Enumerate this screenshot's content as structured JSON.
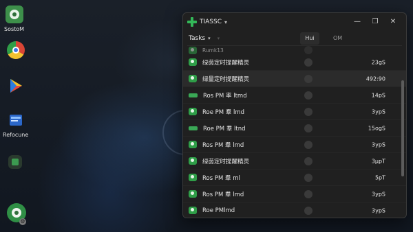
{
  "desktop": {
    "icons": [
      {
        "name": "sosto-app",
        "label": "SostoM"
      },
      {
        "name": "chrome",
        "label": ""
      },
      {
        "name": "play-store",
        "label": ""
      },
      {
        "name": "recycle",
        "label": "Refocune"
      },
      {
        "name": "app-tile",
        "label": ""
      }
    ]
  },
  "window": {
    "title": "TIASSC",
    "controls": {
      "minimize": "—",
      "maximize": "❐",
      "close": "✕"
    },
    "toolbar": {
      "tasks_label": "Tasks",
      "col_hui": "Hui",
      "col_om": "OM"
    },
    "rows": [
      {
        "label": "Rumk13",
        "value": "",
        "icon": "green",
        "partial": true
      },
      {
        "label": "绿茵定时提醒精灵",
        "value": "23gS",
        "icon": "green"
      },
      {
        "label": "绿量定时提醒精灵",
        "value": "492:90",
        "icon": "green",
        "selected": true
      },
      {
        "label": "Ros PM 率 ltmd",
        "value": "14pS",
        "icon": "bar"
      },
      {
        "label": "Roe PM 羣 lmd",
        "value": "3ypS",
        "icon": "green"
      },
      {
        "label": "Roe PM 羣 ltnd",
        "value": "15ogS",
        "icon": "bar"
      },
      {
        "label": "Ros PM 羣 lmd",
        "value": "3ypS",
        "icon": "green"
      },
      {
        "label": "绿茵定时提醒精灵",
        "value": "3μpT",
        "icon": "green"
      },
      {
        "label": "Ros PM 羣 ml",
        "value": "5pT",
        "icon": "green"
      },
      {
        "label": "Ros PM 羣 lmd",
        "value": "3ypS",
        "icon": "green"
      },
      {
        "label": "Roe PMlmd",
        "value": "3ypS",
        "icon": "green"
      }
    ]
  }
}
